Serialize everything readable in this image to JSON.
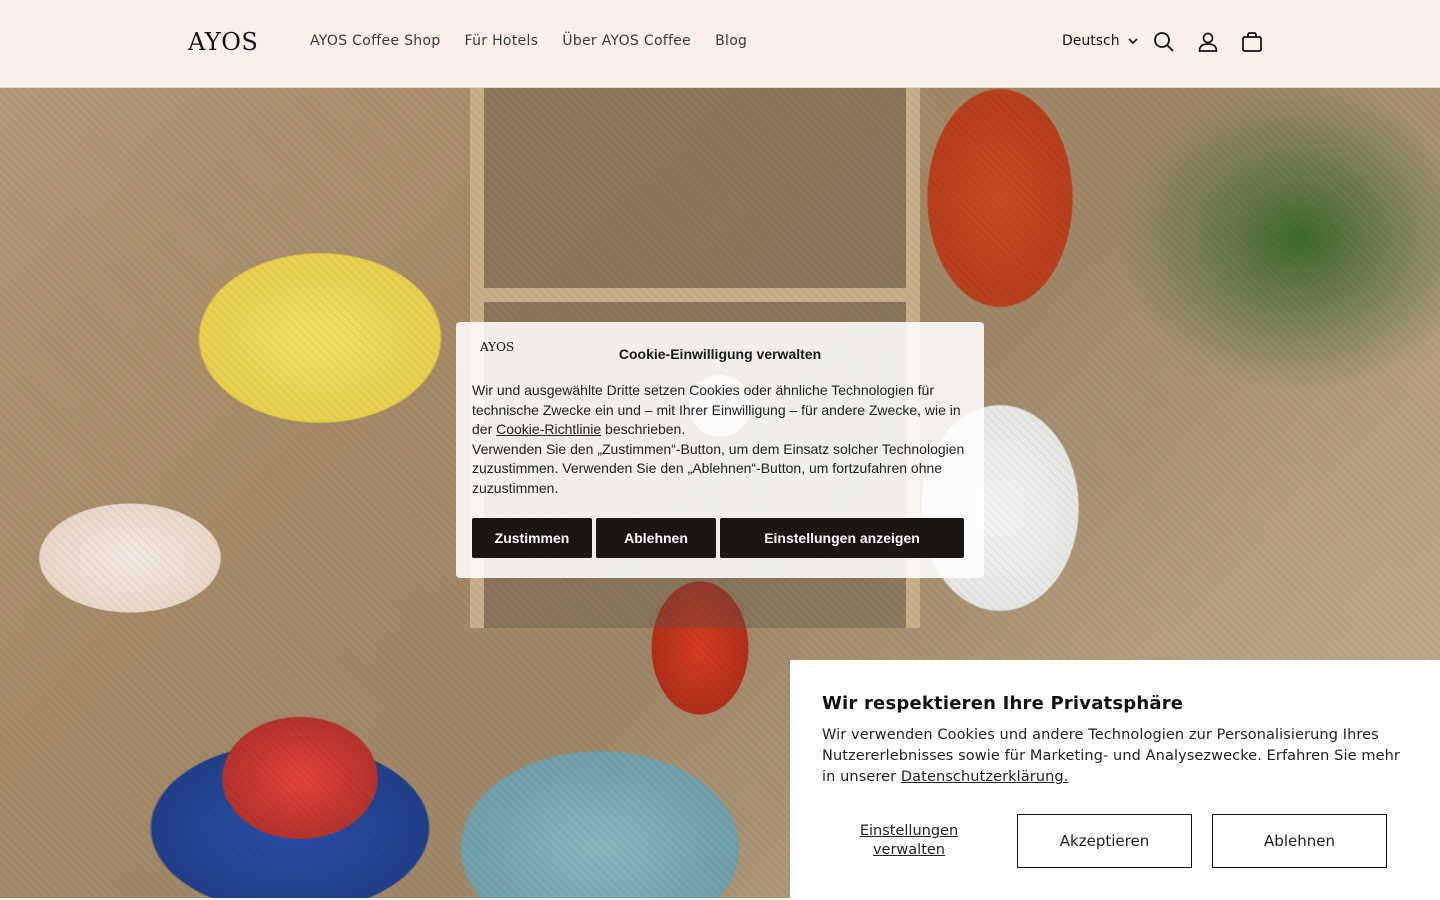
{
  "header": {
    "logo": "AYOS",
    "nav": [
      "AYOS Coffee Shop",
      "Für Hotels",
      "Über AYOS Coffee",
      "Blog"
    ],
    "language": "Deutsch",
    "icons": [
      "search-icon",
      "account-icon",
      "cart-icon"
    ]
  },
  "cookie_modal": {
    "logo": "AYOS",
    "title": "Cookie-Einwilligung verwalten",
    "text_before_link": "Wir und ausgewählte Dritte setzen Cookies oder ähnliche Technologien für technische Zwecke ein und – mit Ihrer Einwilligung – für andere Zwecke, wie in der ",
    "link": "Cookie-Richtlinie",
    "text_after_link": " beschrieben.",
    "text_2": "Verwenden Sie den „Zustimmen“-Button, um dem Einsatz solcher Technologien zuzustimmen. Verwenden Sie den „Ablehnen“-Button, um fortzufahren ohne zuzustimmen.",
    "accept": "Zustimmen",
    "reject": "Ablehnen",
    "settings": "Einstellungen anzeigen"
  },
  "privacy_banner": {
    "title": "Wir respektieren Ihre Privatsphäre",
    "text": "Wir verwenden Cookies und andere Technologien zur Personalisierung Ihres Nutzererlebnisses sowie für Marketing- und Analysezwecke. Erfahren Sie mehr in unserer ",
    "link": "Datenschutzerklärung.",
    "manage": "Einstellungen verwalten",
    "accept": "Akzeptieren",
    "reject": "Ablehnen"
  }
}
